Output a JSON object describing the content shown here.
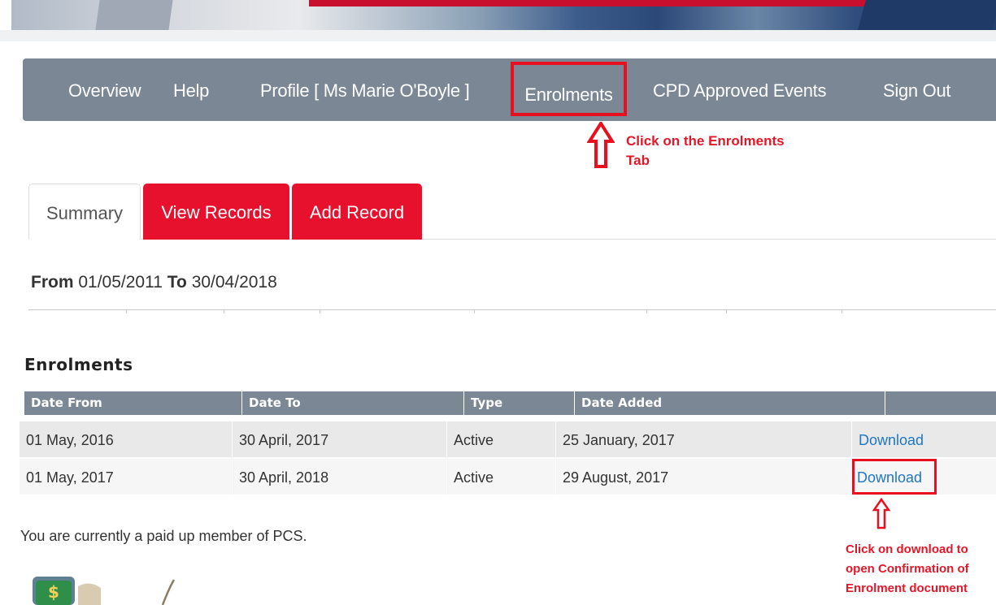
{
  "nav": {
    "overview": "Overview",
    "help": "Help",
    "profile": "Profile [ Ms Marie O'Boyle ]",
    "enrolments": "Enrolments",
    "cpd": "CPD Approved Events",
    "signout": "Sign Out"
  },
  "annotations": {
    "enrolments_tab_line1": "Click on the Enrolments",
    "enrolments_tab_line2": "Tab",
    "download_line1": "Click on download to",
    "download_line2": "open Confirmation of",
    "download_line3": "Enrolment document",
    "color": "#e0182a"
  },
  "tabs": {
    "summary": "Summary",
    "view_records": "View Records",
    "add_record": "Add Record"
  },
  "range": {
    "from_label": "From",
    "from_value": "01/05/2011",
    "to_label": "To",
    "to_value": "30/04/2018"
  },
  "enrolments": {
    "heading": "Enrolments",
    "columns": [
      "Date From",
      "Date To",
      "Type",
      "Date Added",
      ""
    ],
    "rows": [
      {
        "date_from": "01 May, 2016",
        "date_to": "30 April, 2017",
        "type": "Active",
        "date_added": "25 January, 2017",
        "action": "Download"
      },
      {
        "date_from": "01 May, 2017",
        "date_to": "30 April, 2018",
        "type": "Active",
        "date_added": "29 August, 2017",
        "action": "Download"
      }
    ]
  },
  "status_message": "You are currently a paid up member of PCS.",
  "colors": {
    "nav_bg": "#7b8794",
    "tab_red": "#e8112d",
    "link_blue": "#2176c7",
    "highlight_red": "#e8101f"
  }
}
